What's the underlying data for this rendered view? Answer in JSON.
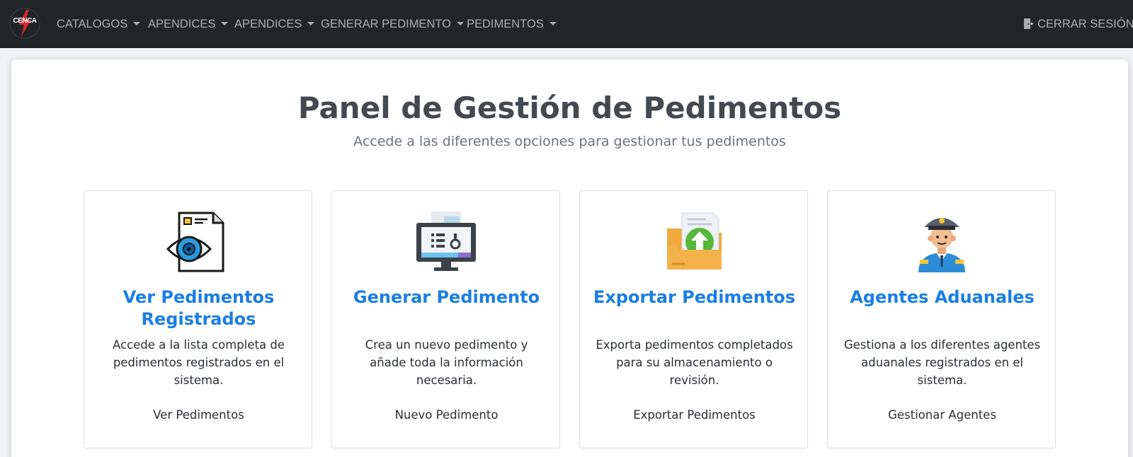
{
  "navbar": {
    "logo_text": "CENCA",
    "items": [
      {
        "label": "CATALOGOS"
      },
      {
        "label": "APENDICES"
      },
      {
        "label": "APENDICES"
      },
      {
        "label": "GENERAR PEDIMENTO"
      },
      {
        "label": "PEDIMENTOS"
      }
    ],
    "logout_label": "CERRAR SESIÓN",
    "logout_icon": "door-exit-icon"
  },
  "main": {
    "title": "Panel de Gestión de Pedimentos",
    "subtitle": "Accede a las diferentes opciones para gestionar tus pedimentos",
    "cards": [
      {
        "icon": "document-eye-icon",
        "title": "Ver Pedimentos Registrados",
        "text": "Accede a la lista completa de pedimentos registrados en el sistema.",
        "link": "Ver Pedimentos"
      },
      {
        "icon": "monitor-form-icon",
        "title": "Generar Pedimento",
        "text": "Crea un nuevo pedimento y añade toda la información necesaria.",
        "link": "Nuevo Pedimento"
      },
      {
        "icon": "folder-upload-icon",
        "title": "Exportar Pedimentos",
        "text": "Exporta pedimentos completados para su almacenamiento o revisión.",
        "link": "Exportar Pedimentos"
      },
      {
        "icon": "customs-agent-icon",
        "title": "Agentes Aduanales",
        "text": "Gestiona a los diferentes agentes aduanales registrados en el sistema.",
        "link": "Gestionar Agentes"
      }
    ]
  },
  "colors": {
    "navbar_bg": "#212529",
    "card_title": "#1a7ee2",
    "title_text": "#444950"
  }
}
